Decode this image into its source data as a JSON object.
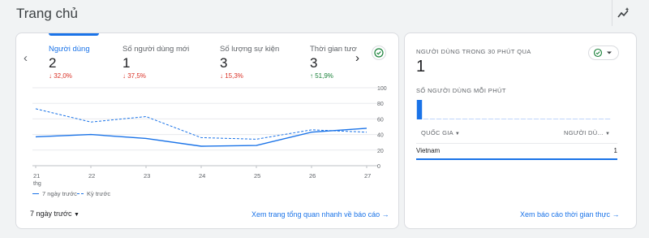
{
  "header": {
    "title": "Trang chủ",
    "insights_icon": "insights-sparkline-icon"
  },
  "overview": {
    "metrics": [
      {
        "label": "Người dùng",
        "value": "2",
        "change": "32,0%",
        "trend": "down",
        "active": true
      },
      {
        "label": "Số người dùng mới",
        "value": "1",
        "change": "37,5%",
        "trend": "down"
      },
      {
        "label": "Số lượng sự kiện",
        "value": "3",
        "change": "15,3%",
        "trend": "down"
      },
      {
        "label": "Thời gian tươ",
        "value": "3",
        "change": "51,9%",
        "trend": "up"
      }
    ],
    "date_range": "7 ngày trước",
    "link": "Xem trang tổng quan nhanh về báo cáo"
  },
  "chart_data": {
    "type": "line",
    "x": [
      "21",
      "22",
      "23",
      "24",
      "25",
      "26",
      "27"
    ],
    "x_sublabel": "thg",
    "ylim": [
      0,
      100
    ],
    "yticks": [
      "100",
      "80",
      "60",
      "40",
      "20",
      "0"
    ],
    "series": [
      {
        "name": "7 ngày trước",
        "style": "solid",
        "values": [
          37,
          40,
          35,
          25,
          26,
          43,
          48
        ]
      },
      {
        "name": "Kỳ trước",
        "style": "dashed",
        "values": [
          73,
          56,
          63,
          36,
          34,
          46,
          43
        ]
      }
    ],
    "color": "#1a73e8"
  },
  "realtime": {
    "title": "NGƯỜI DÙNG TRONG 30 PHÚT QUA",
    "value": "1",
    "subtitle": "SỐ NGƯỜI DÙNG MỖI PHÚT",
    "minute_bars": [
      1,
      0,
      0,
      0,
      0,
      0,
      0,
      0,
      0,
      0,
      0,
      0,
      0,
      0,
      0,
      0,
      0,
      0,
      0,
      0,
      0,
      0,
      0,
      0,
      0,
      0,
      0,
      0,
      0,
      0
    ],
    "table": {
      "col_country": "QUỐC GIA",
      "col_users": "NGƯỜI DÙ...",
      "rows": [
        {
          "country": "Vietnam",
          "users": "1"
        }
      ]
    },
    "link": "Xem báo cáo thời gian thực"
  },
  "colors": {
    "accent": "#1a73e8",
    "down": "#d93025",
    "up": "#188038",
    "text": "#202124",
    "muted": "#5f6368"
  }
}
